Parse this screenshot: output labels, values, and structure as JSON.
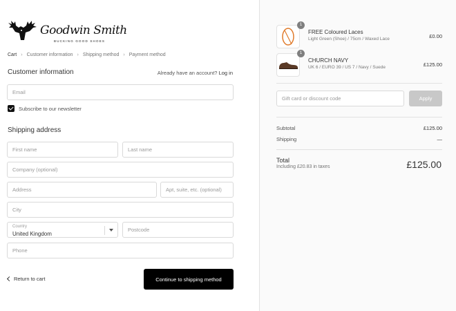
{
  "brand": {
    "name": "Goodwin Smith",
    "tagline": "BUCKING GOOD SHOES"
  },
  "breadcrumb": [
    {
      "label": "Cart"
    },
    {
      "label": "Customer information"
    },
    {
      "label": "Shipping method"
    },
    {
      "label": "Payment method"
    }
  ],
  "customer": {
    "title": "Customer information",
    "account_prompt": "Already have an account?",
    "login_label": "Log in",
    "email_placeholder": "Email",
    "newsletter_label": "Subscribe to our newsletter",
    "newsletter_checked": true
  },
  "shipping": {
    "title": "Shipping address",
    "first_name_placeholder": "First name",
    "last_name_placeholder": "Last name",
    "company_placeholder": "Company (optional)",
    "address_placeholder": "Address",
    "apt_placeholder": "Apt, suite, etc. (optional)",
    "city_placeholder": "City",
    "country_label": "Country",
    "country_value": "United Kingdom",
    "postcode_placeholder": "Postcode",
    "phone_placeholder": "Phone"
  },
  "actions": {
    "return_label": "Return to cart",
    "continue_label": "Continue to shipping method"
  },
  "order": {
    "items": [
      {
        "qty": "1",
        "name": "FREE Coloured Laces",
        "variant": "Light Green (Shoe) / 75cm / Waxed Lace",
        "price": "£0.00",
        "thumb_icon": "orange-lace-icon"
      },
      {
        "qty": "1",
        "name": "CHURCH NAVY",
        "variant": "UK 6 / EURO 39 / US 7 / Navy / Suede",
        "price": "£125.00",
        "thumb_icon": "brown-shoe-icon"
      }
    ],
    "discount_placeholder": "Gift card or discount code",
    "apply_label": "Apply",
    "subtotal_label": "Subtotal",
    "subtotal_value": "£125.00",
    "shipping_label": "Shipping",
    "shipping_value": "—",
    "total_label": "Total",
    "taxes_note": "Including £20.83 in taxes",
    "total_value": "£125.00"
  },
  "colors": {
    "button_dark": "#000000",
    "apply_disabled": "#c8c8c8",
    "sidebar_bg": "#fafafa"
  }
}
